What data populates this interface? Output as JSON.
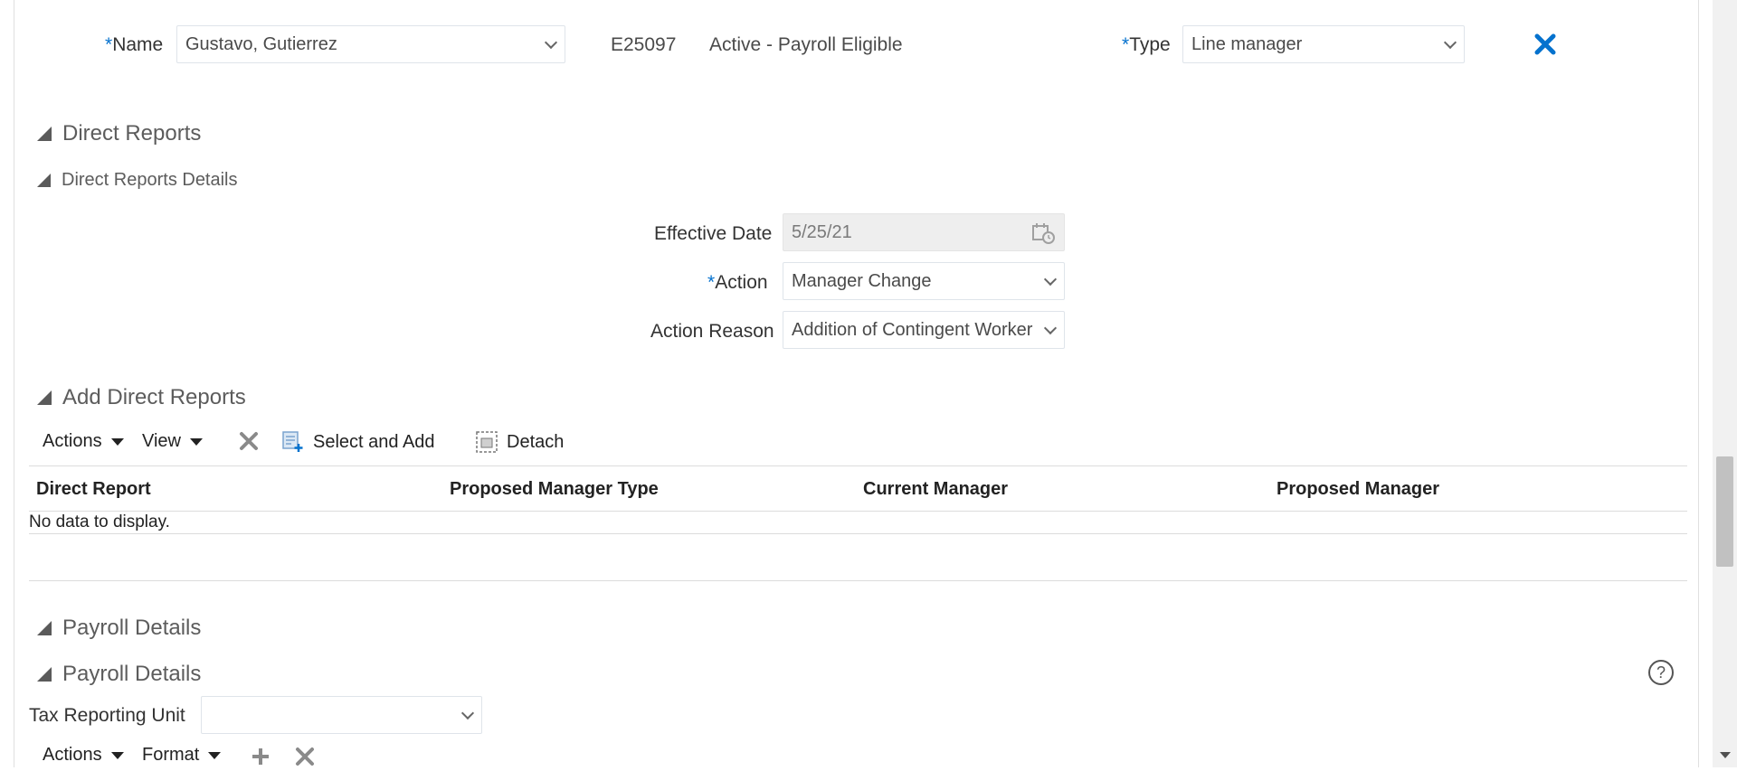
{
  "colors": {
    "accent": "#0572ce",
    "required": "#0572ce"
  },
  "header": {
    "name_required": "*",
    "name_label": "Name",
    "name_value": "Gustavo, Gutierrez",
    "person_number": "E25097",
    "assignment_status": "Active - Payroll Eligible",
    "type_required": "*",
    "type_label": "Type",
    "type_value": "Line manager",
    "remove_icon": "close-x-icon"
  },
  "direct_reports": {
    "title": "Direct Reports",
    "details_title": "Direct Reports Details",
    "effective_date_label": "Effective Date",
    "effective_date_value": "5/25/21",
    "action_required": "*",
    "action_label": "Action",
    "action_value": "Manager Change",
    "action_reason_label": "Action Reason",
    "action_reason_value": "Addition of Contingent Worker"
  },
  "add_direct_reports": {
    "title": "Add Direct Reports",
    "toolbar": {
      "actions_label": "Actions",
      "view_label": "View",
      "select_add_label": "Select and Add",
      "detach_label": "Detach"
    },
    "columns": [
      "Direct Report",
      "Proposed Manager Type",
      "Current Manager",
      "Proposed Manager"
    ],
    "empty_message": "No data to display."
  },
  "payroll": {
    "title": "Payroll Details",
    "sub_title": "Payroll Details",
    "help_icon": "?",
    "tax_reporting_unit_label": "Tax Reporting Unit",
    "tax_reporting_unit_value": "",
    "toolbar": {
      "actions_label": "Actions",
      "format_label": "Format"
    }
  }
}
